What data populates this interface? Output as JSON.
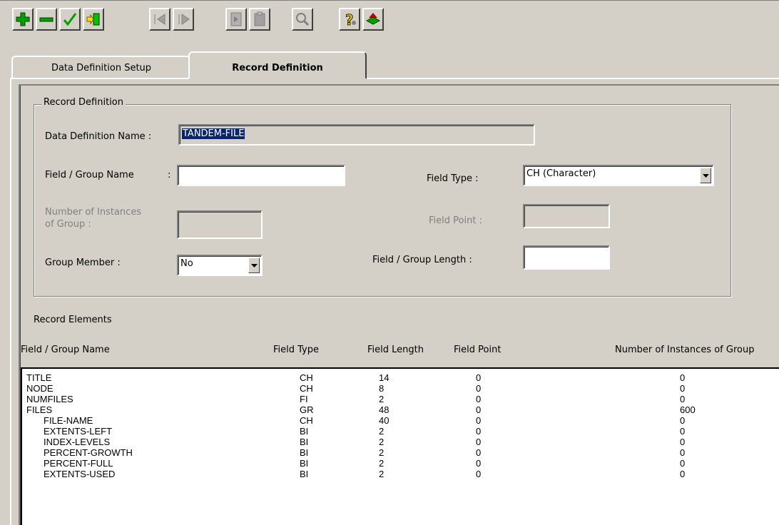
{
  "toolbar": {
    "buttons": [
      {
        "name": "add-icon",
        "enabled": true
      },
      {
        "name": "remove-icon",
        "enabled": true
      },
      {
        "name": "checkmark-icon",
        "enabled": true
      },
      {
        "name": "insert-icon",
        "enabled": true
      },
      {
        "name": "first-record-icon",
        "enabled": false
      },
      {
        "name": "next-record-icon",
        "enabled": false
      },
      {
        "name": "copy-icon",
        "enabled": false
      },
      {
        "name": "paste-icon",
        "enabled": false
      },
      {
        "name": "search-icon",
        "enabled": false
      },
      {
        "name": "help-icon",
        "enabled": true
      },
      {
        "name": "navigate-icon",
        "enabled": true
      }
    ]
  },
  "tabs": [
    {
      "label": "Data Definition Setup",
      "active": false
    },
    {
      "label": "Record Definition",
      "active": true
    }
  ],
  "form": {
    "group_title": "Record Definition",
    "data_def_name_label": "Data Definition Name :",
    "data_def_name_value": "TANDEM-FILE",
    "field_group_name_label": "Field / Group Name",
    "field_group_name_colon": ":",
    "field_group_name_value": "",
    "num_instances_label_1": "Number of Instances",
    "num_instances_label_2": "of Group  :",
    "num_instances_value": "",
    "group_member_label": "Group Member :",
    "group_member_value": "No",
    "field_type_label": "Field Type :",
    "field_type_value": "CH (Character)",
    "field_point_label": "Field Point :",
    "field_point_value": "",
    "field_group_length_label": "Field / Group Length :",
    "field_group_length_value": ""
  },
  "record_elements": {
    "title": "Record Elements",
    "columns": [
      "Field / Group Name",
      "Field Type",
      "Field Length",
      "Field Point",
      "Number of Instances of Group"
    ],
    "rows": [
      {
        "name": "TITLE",
        "indent": 0,
        "type": "CH",
        "length": "14",
        "point": "0",
        "instances": "0"
      },
      {
        "name": "NODE",
        "indent": 0,
        "type": "CH",
        "length": "8",
        "point": "0",
        "instances": "0"
      },
      {
        "name": "NUMFILES",
        "indent": 0,
        "type": "FI",
        "length": "2",
        "point": "0",
        "instances": "0"
      },
      {
        "name": "FILES",
        "indent": 0,
        "type": "GR",
        "length": "48",
        "point": "0",
        "instances": "600"
      },
      {
        "name": "FILE-NAME",
        "indent": 1,
        "type": "CH",
        "length": "40",
        "point": "0",
        "instances": "0"
      },
      {
        "name": "EXTENTS-LEFT",
        "indent": 1,
        "type": "BI",
        "length": "2",
        "point": "0",
        "instances": "0"
      },
      {
        "name": "INDEX-LEVELS",
        "indent": 1,
        "type": "BI",
        "length": "2",
        "point": "0",
        "instances": "0"
      },
      {
        "name": "PERCENT-GROWTH",
        "indent": 1,
        "type": "BI",
        "length": "2",
        "point": "0",
        "instances": "0"
      },
      {
        "name": "PERCENT-FULL",
        "indent": 1,
        "type": "BI",
        "length": "2",
        "point": "0",
        "instances": "0"
      },
      {
        "name": "EXTENTS-USED",
        "indent": 1,
        "type": "BI",
        "length": "2",
        "point": "0",
        "instances": "0"
      }
    ]
  },
  "colors": {
    "selection": "#0a246a",
    "face": "#d4d0c8"
  }
}
